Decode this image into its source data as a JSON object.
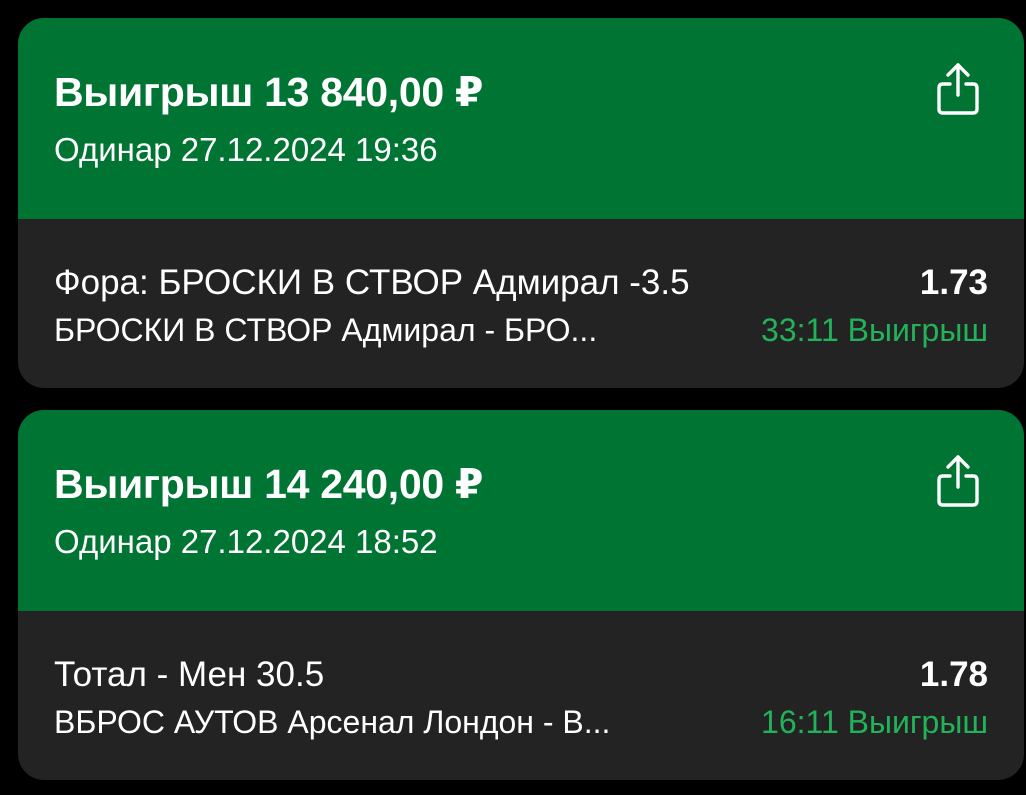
{
  "bets": [
    {
      "title": "Выигрыш 13 840,00 ₽",
      "subtitle": "Одинар 27.12.2024 19:36",
      "market": "Фора: БРОСКИ В СТВОР Адмирал -3.5",
      "odds": "1.73",
      "event": "БРОСКИ В СТВОР Адмирал - БРО...",
      "result": "33:11 Выигрыш"
    },
    {
      "title": "Выигрыш 14 240,00 ₽",
      "subtitle": "Одинар 27.12.2024 18:52",
      "market": "Тотал - Мен 30.5",
      "odds": "1.78",
      "event": "ВБРОС АУТОВ Арсенал Лондон - В...",
      "result": "16:11 Выигрыш"
    }
  ],
  "icons": {
    "share": "share-icon"
  },
  "colors": {
    "header_green": "#007433",
    "card_body": "#232323",
    "background": "#000000",
    "win_green": "#22b35a",
    "text": "#ffffff"
  }
}
